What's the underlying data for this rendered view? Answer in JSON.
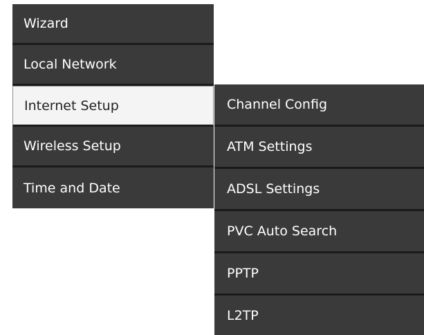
{
  "main_menu": {
    "items": [
      {
        "label": "Wizard"
      },
      {
        "label": "Local Network"
      },
      {
        "label": "Internet Setup"
      },
      {
        "label": "Wireless Setup"
      },
      {
        "label": "Time and Date"
      }
    ],
    "active_item": "Internet Setup"
  },
  "sub_menu": {
    "parent": "Internet Setup",
    "items": [
      {
        "label": "Channel Config"
      },
      {
        "label": "ATM Settings"
      },
      {
        "label": "ADSL Settings"
      },
      {
        "label": "PVC Auto Search"
      },
      {
        "label": "PPTP"
      },
      {
        "label": "L2TP"
      }
    ]
  },
  "colors": {
    "menu_background": "#3a3a3a",
    "menu_divider": "#1a1a1a",
    "menu_text": "#ffffff",
    "active_background": "#f4f4f4",
    "active_text": "#222222"
  }
}
